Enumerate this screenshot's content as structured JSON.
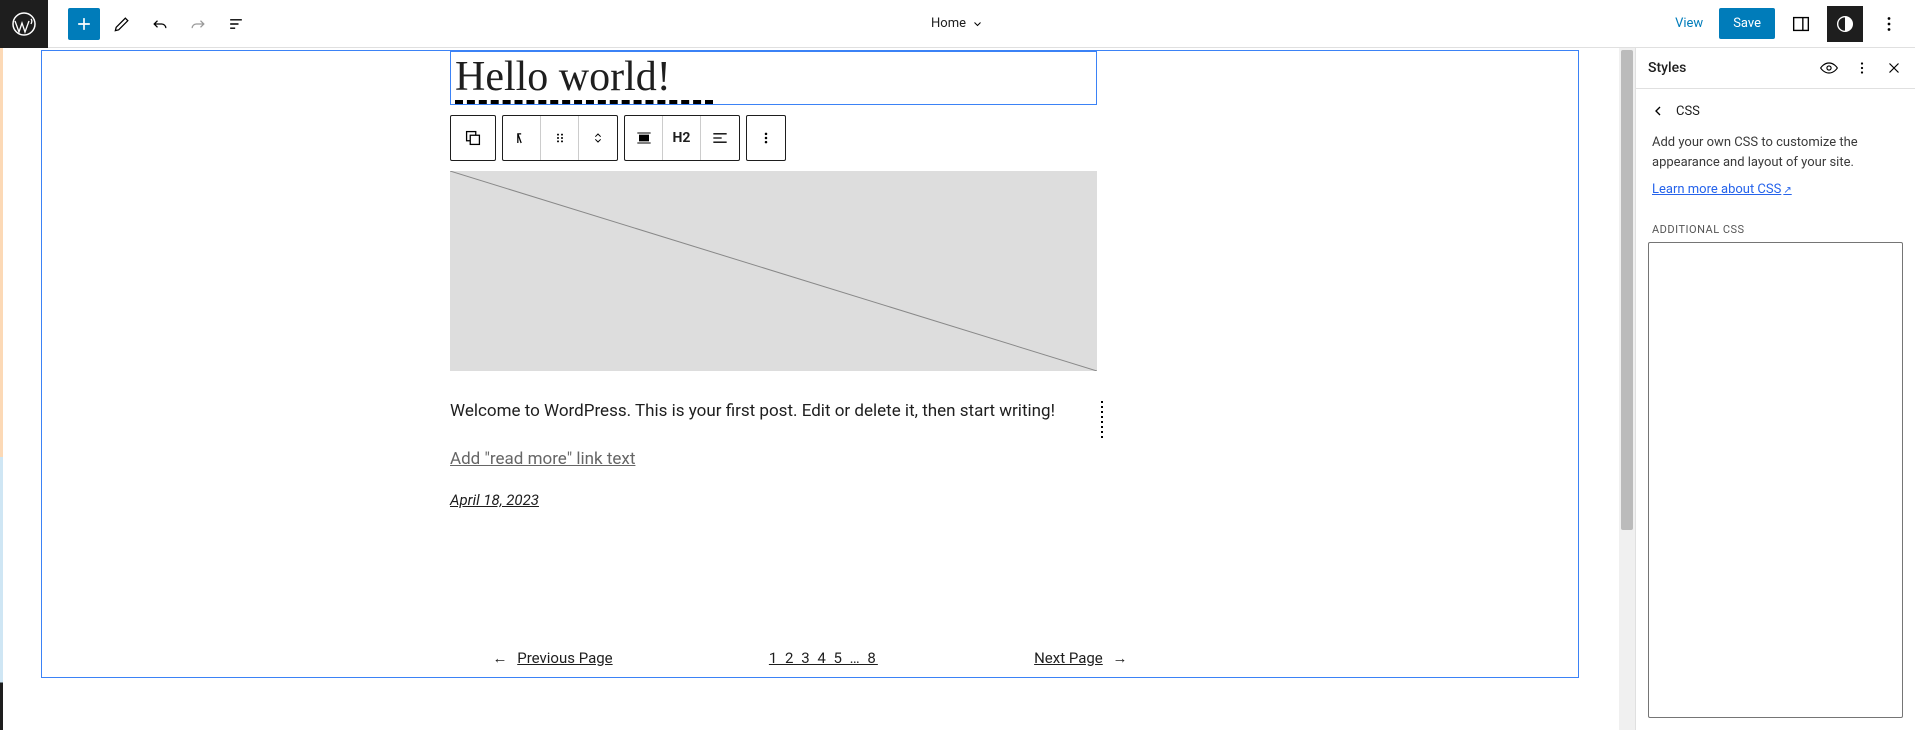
{
  "topbar": {
    "page_title": "Home",
    "view": "View",
    "save": "Save"
  },
  "editor": {
    "heading": "Hello world!",
    "toolbar_heading_level": "H2",
    "excerpt": "Welcome to WordPress. This is your first post. Edit or delete it, then start writing!",
    "read_more": "Add \"read more\" link text",
    "post_date": "April 18, 2023",
    "pagination": {
      "prev": "Previous Page",
      "numbers": "1 2 3 4 5 … 8",
      "next": "Next Page"
    }
  },
  "sidebar": {
    "panel_title": "Styles",
    "section": "CSS",
    "description": "Add your own CSS to customize the appearance and layout of your site.",
    "learn_more": "Learn more about CSS",
    "field_label": "ADDITIONAL CSS"
  }
}
